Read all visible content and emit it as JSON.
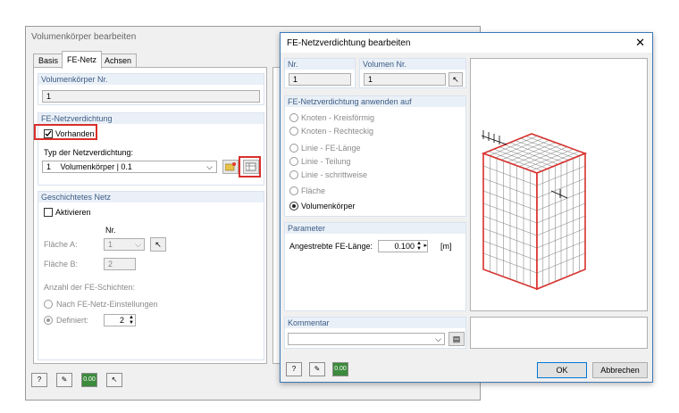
{
  "back_dialog": {
    "title": "Volumenkörper bearbeiten",
    "tabs": [
      "Basis",
      "FE-Netz",
      "Achsen"
    ],
    "solid_no_header": "Volumenkörper Nr.",
    "solid_no_value": "1",
    "mesh_refinement_header": "FE-Netzverdichtung",
    "present_label": "Vorhanden",
    "type_label": "Typ der Netzverdichtung:",
    "type_no": "1",
    "type_value": "Volumenkörper | 0.1",
    "layered_header": "Geschichtetes Netz",
    "activate_label": "Aktivieren",
    "nr_label": "Nr.",
    "surface_a_label": "Fläche A:",
    "surface_a_value": "1",
    "surface_b_label": "Fläche B:",
    "surface_b_value": "2",
    "layers_count_label": "Anzahl der FE-Schichten:",
    "by_settings_label": "Nach FE-Netz-Einstellungen",
    "defined_label": "Definiert:",
    "defined_value": "2"
  },
  "front_dialog": {
    "title": "FE-Netzverdichtung bearbeiten",
    "nr_header": "Nr.",
    "nr_value": "1",
    "solid_no_header": "Volumen Nr.",
    "solid_no_value": "1",
    "apply_header": "FE-Netzverdichtung anwenden auf",
    "options": [
      "Knoten - Kreisförmig",
      "Knoten - Rechteckig",
      "Linie - FE-Länge",
      "Linie - Teilung",
      "Linie - schrittweise",
      "Fläche",
      "Volumenkörper"
    ],
    "param_header": "Parameter",
    "target_length_label": "Angestrebte FE-Länge:",
    "target_length_value": "0.100",
    "target_length_unit": "[m]",
    "comment_header": "Kommentar",
    "ok_label": "OK",
    "cancel_label": "Abbrechen"
  },
  "colors": {
    "highlight_red": "#d9302c",
    "section_header_bg": "#eaf0f7",
    "section_header_text": "#3b5b85",
    "accent_blue": "#0078d7"
  }
}
